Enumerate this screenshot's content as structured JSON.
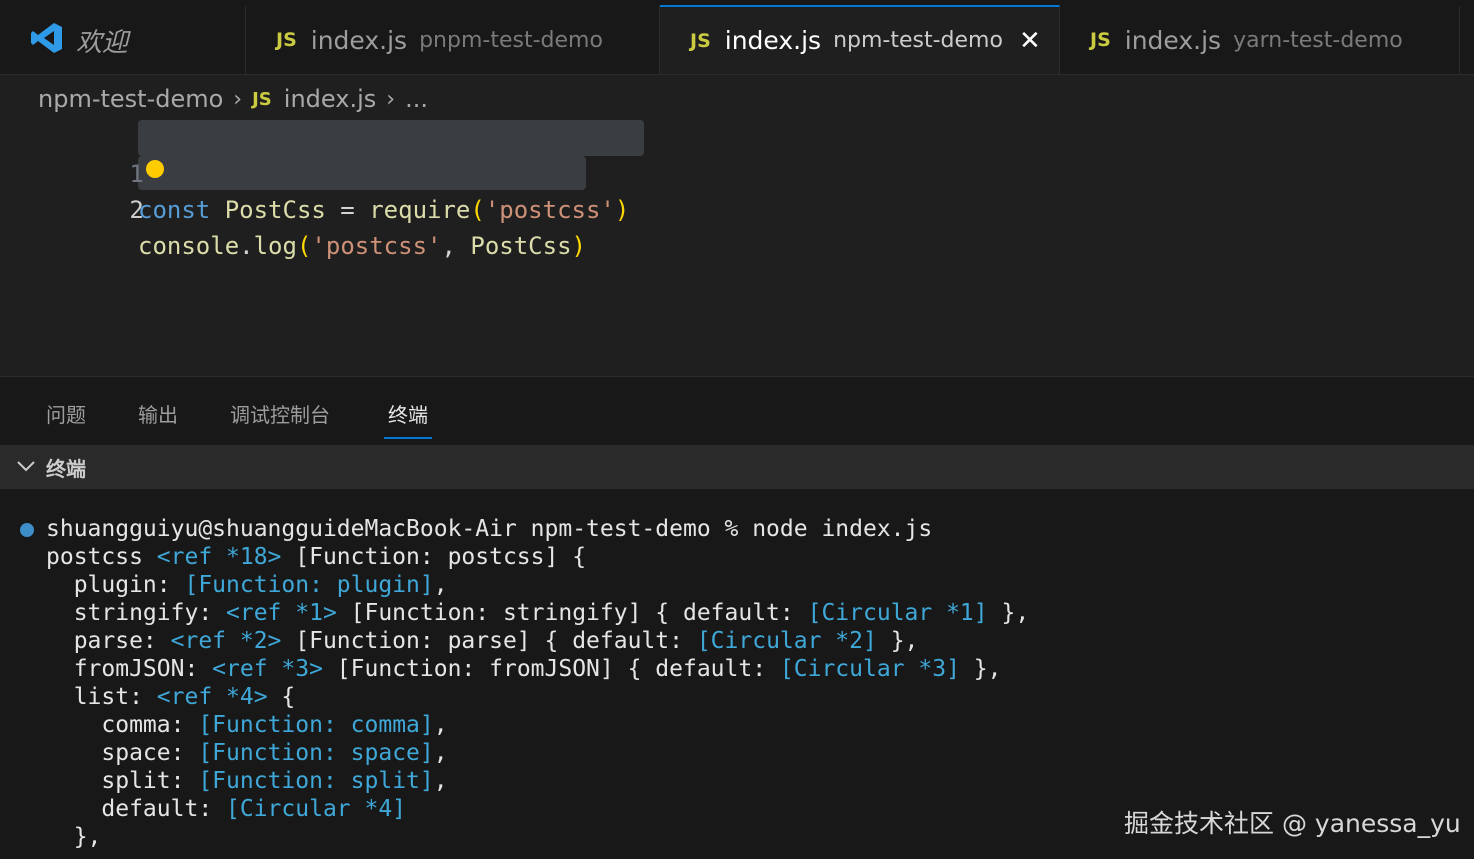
{
  "tabs": {
    "welcome_label": "欢迎",
    "items": [
      {
        "icon": "JS",
        "name": "index.js",
        "desc": "pnpm-test-demo"
      },
      {
        "icon": "JS",
        "name": "index.js",
        "desc": "npm-test-demo",
        "close": "✕"
      },
      {
        "icon": "JS",
        "name": "index.js",
        "desc": "yarn-test-demo"
      }
    ]
  },
  "breadcrumb": {
    "folder": "npm-test-demo",
    "sep": "›",
    "icon": "JS",
    "file": "index.js",
    "more": "..."
  },
  "editor": {
    "lines": [
      {
        "num": "1",
        "tokens": {
          "kw": "const",
          "var": "PostCss",
          "eq": " = ",
          "fn": "require",
          "open": "(",
          "str": "'postcss'",
          "close": ")"
        }
      },
      {
        "num": "2",
        "tokens": {
          "obj": "console",
          "dot": ".",
          "fn": "log",
          "open": "(",
          "str": "'postcss'",
          "comma": ", ",
          "var": "PostCss",
          "close": ")"
        }
      }
    ]
  },
  "panel": {
    "tabs": [
      "问题",
      "输出",
      "调试控制台",
      "终端"
    ],
    "section_title": "终端"
  },
  "terminal": {
    "prompt": "shuangguiyu@shuangguideMacBook-Air npm-test-demo % node index.js",
    "lines": [
      [
        {
          "t": "postcss "
        },
        {
          "t": "<ref *18>",
          "c": true
        },
        {
          "t": " [Function: postcss] {"
        }
      ],
      [
        {
          "t": "  plugin: "
        },
        {
          "t": "[Function: plugin]",
          "c": true
        },
        {
          "t": ","
        }
      ],
      [
        {
          "t": "  stringify: "
        },
        {
          "t": "<ref *1>",
          "c": true
        },
        {
          "t": " [Function: stringify] { default: "
        },
        {
          "t": "[Circular *1]",
          "c": true
        },
        {
          "t": " },"
        }
      ],
      [
        {
          "t": "  parse: "
        },
        {
          "t": "<ref *2>",
          "c": true
        },
        {
          "t": " [Function: parse] { default: "
        },
        {
          "t": "[Circular *2]",
          "c": true
        },
        {
          "t": " },"
        }
      ],
      [
        {
          "t": "  fromJSON: "
        },
        {
          "t": "<ref *3>",
          "c": true
        },
        {
          "t": " [Function: fromJSON] { default: "
        },
        {
          "t": "[Circular *3]",
          "c": true
        },
        {
          "t": " },"
        }
      ],
      [
        {
          "t": "  list: "
        },
        {
          "t": "<ref *4>",
          "c": true
        },
        {
          "t": " {"
        }
      ],
      [
        {
          "t": "    comma: "
        },
        {
          "t": "[Function: comma]",
          "c": true
        },
        {
          "t": ","
        }
      ],
      [
        {
          "t": "    space: "
        },
        {
          "t": "[Function: space]",
          "c": true
        },
        {
          "t": ","
        }
      ],
      [
        {
          "t": "    split: "
        },
        {
          "t": "[Function: split]",
          "c": true
        },
        {
          "t": ","
        }
      ],
      [
        {
          "t": "    default: "
        },
        {
          "t": "[Circular *4]",
          "c": true
        }
      ],
      [
        {
          "t": "  },"
        }
      ]
    ]
  },
  "watermark": "掘金技术社区 @ yanessa_yu",
  "colors": {
    "accent": "#0078d4",
    "js_icon": "#cbcb41",
    "terminal_cyan": "#3fa8d8"
  }
}
